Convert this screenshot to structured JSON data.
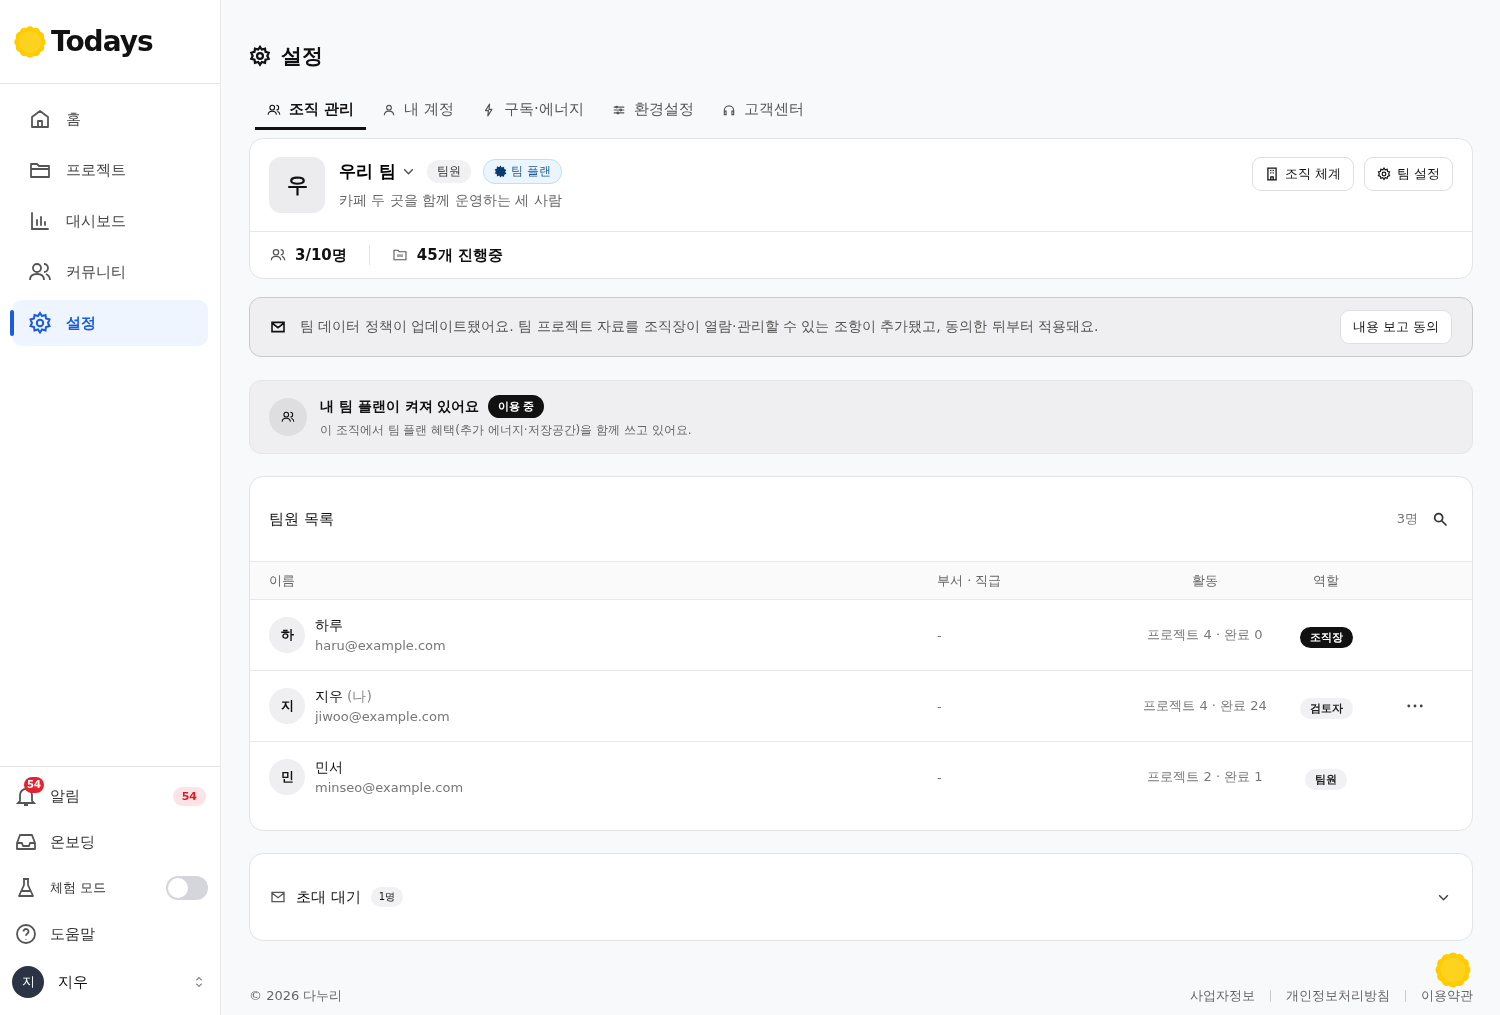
{
  "brand": {
    "name": "Todays"
  },
  "nav": [
    {
      "label": "홈",
      "selected": false
    },
    {
      "label": "프로젝트",
      "selected": false
    },
    {
      "label": "대시보드",
      "selected": false
    },
    {
      "label": "커뮤니티",
      "selected": false
    },
    {
      "label": "설정",
      "selected": true
    }
  ],
  "sidebar_bottom": {
    "alerts": {
      "label": "알림",
      "icon_badge": "54",
      "count": "54"
    },
    "onboarding": {
      "label": "온보딩"
    },
    "trial": {
      "label": "체험 모드",
      "on": false
    },
    "help": {
      "label": "도움말"
    },
    "user": {
      "initial": "지",
      "name": "지우"
    }
  },
  "page_title": "설정",
  "tabs": [
    {
      "label": "조직 관리",
      "selected": true
    },
    {
      "label": "내 계정",
      "selected": false
    },
    {
      "label": "구독·에너지",
      "selected": false
    },
    {
      "label": "환경설정",
      "selected": false
    },
    {
      "label": "고객센터",
      "selected": false
    }
  ],
  "team": {
    "initial": "우",
    "name": "우리 팀",
    "role": "팀원",
    "plan": "팀 플랜",
    "description": "카페 두 곳을 함께 운영하는 세 사람",
    "buttons": [
      "조직 체계",
      "팀 설정"
    ],
    "members": "3/10명",
    "projects": "45개 진행중"
  },
  "notice": {
    "text": "팀 데이터 정책이 업데이트됐어요. 팀 프로젝트 자료를 조직장이 열람·관리할 수 있는 조항이 추가됐고, 동의한 뒤부터 적용돼요.",
    "button": "내용 보고 동의"
  },
  "plan_banner": {
    "title": "내 팀 플랜이 켜져 있어요",
    "badge": "이용 중",
    "description": "이 조직에서 팀 플랜 혜택(추가 에너지·저장공간)을 함께 쓰고 있어요."
  },
  "member_list": {
    "title": "팀원 목록",
    "count": "3명",
    "columns": [
      "이름",
      "부서 · 직급",
      "활동",
      "역할"
    ],
    "rows": [
      {
        "initial": "하",
        "name": "하루",
        "suffix": "",
        "email": "haru@example.com",
        "department": "-",
        "activity": "프로젝트 4 · 완료 0",
        "role": "조직장",
        "kind": "owner",
        "has_menu": false
      },
      {
        "initial": "지",
        "name": "지우",
        "suffix": "(나)",
        "email": "jiwoo@example.com",
        "department": "-",
        "activity": "프로젝트 4 · 완료 24",
        "role": "검토자",
        "kind": "reviewer",
        "has_menu": true
      },
      {
        "initial": "민",
        "name": "민서",
        "suffix": "",
        "email": "minseo@example.com",
        "department": "-",
        "activity": "프로젝트 2 · 완료 1",
        "role": "팀원",
        "kind": "member",
        "has_menu": false
      }
    ]
  },
  "invites": {
    "title": "초대 대기",
    "count": "1명",
    "expanded": false
  },
  "footer": {
    "copyright": "© 2026 다누리",
    "links": [
      "사업자정보",
      "개인정보처리방침",
      "이용약관"
    ]
  }
}
